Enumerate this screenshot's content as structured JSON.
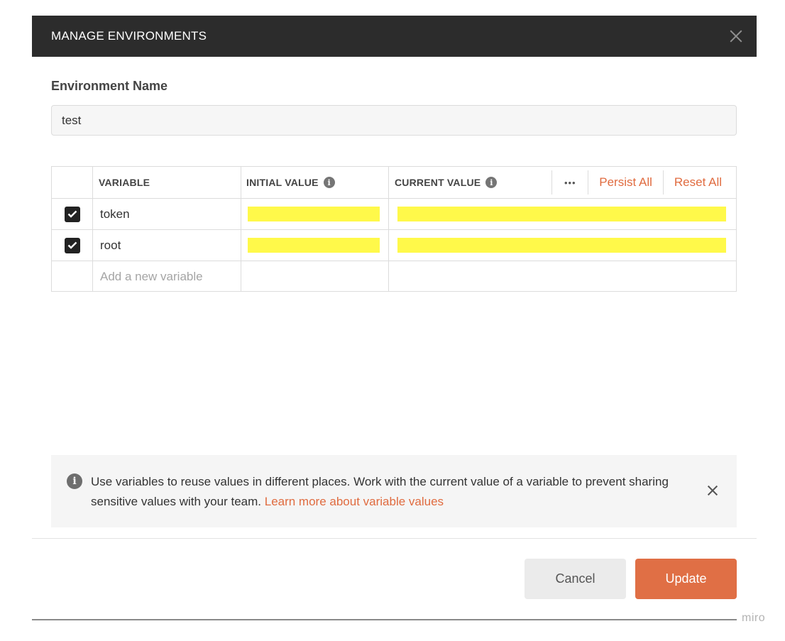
{
  "header": {
    "title": "MANAGE ENVIRONMENTS"
  },
  "environment": {
    "name_label": "Environment Name",
    "name_value": "test"
  },
  "table": {
    "columns": {
      "variable": "VARIABLE",
      "initial_value": "INITIAL VALUE",
      "current_value": "CURRENT VALUE"
    },
    "more_label": "•••",
    "persist_all": "Persist All",
    "reset_all": "Reset All",
    "rows": [
      {
        "checked": true,
        "name": "token",
        "initial_value": "",
        "current_value": ""
      },
      {
        "checked": true,
        "name": "root",
        "initial_value": "",
        "current_value": ""
      }
    ],
    "add_placeholder": "Add a new variable",
    "highlight_color": "#fff94a"
  },
  "banner": {
    "text": "Use variables to reuse values in different places. Work with the current value of a variable to prevent sharing sensitive values with your team.",
    "link": "Learn more about variable values"
  },
  "footer": {
    "cancel_label": "Cancel",
    "update_label": "Update"
  },
  "colors": {
    "accent": "#e06f45",
    "header_bg": "#2c2c2c",
    "link": "#e06b3f"
  },
  "watermark": "miro"
}
